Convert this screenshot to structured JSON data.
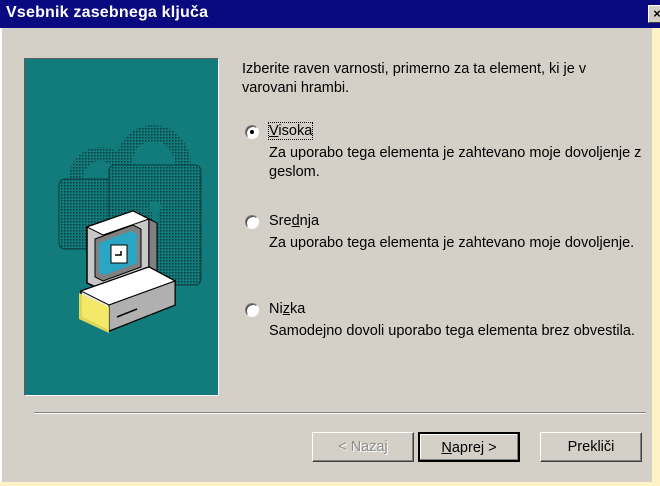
{
  "window": {
    "title": "Vsebnik zasebnega ključa",
    "close_glyph": "×"
  },
  "illustration": {
    "icon": "computer-with-padlock-icon",
    "panel_color": "#127b7b"
  },
  "instruction": "Izberite raven varnosti, primerno za ta element, ki je v varovani hrambi.",
  "options": [
    {
      "label_before": "",
      "label_mnemonic": "V",
      "label_after": "isoka",
      "description": "Za uporabo tega elementa je zahtevano moje dovoljenje z geslom.",
      "selected": true
    },
    {
      "label_before": "Sre",
      "label_mnemonic": "d",
      "label_after": "nja",
      "description": "Za uporabo tega elementa je zahtevano moje dovoljenje.",
      "selected": false
    },
    {
      "label_before": "Ni",
      "label_mnemonic": "z",
      "label_after": "ka",
      "description": "Samodejno dovoli uporabo tega elementa brez obvestila.",
      "selected": false
    }
  ],
  "buttons": {
    "back": "< Nazaj",
    "next_mnemonic": "N",
    "next_rest": "aprej >",
    "cancel": "Prekliči"
  },
  "colors": {
    "titlebar": "#0a0a80",
    "dialog_face": "#d4d0c8",
    "backdrop": "#fdf3c4"
  }
}
